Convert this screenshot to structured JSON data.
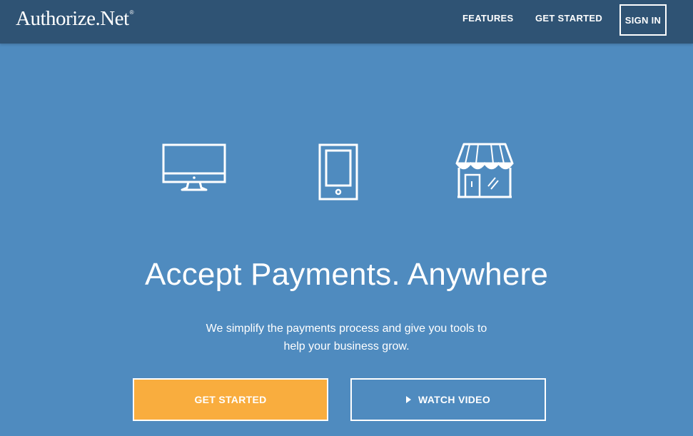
{
  "header": {
    "logo_text": "Authorize.Net",
    "logo_mark": "®",
    "nav": {
      "features": "FEATURES",
      "get_started": "GET STARTED",
      "sign_in": "SIGN IN"
    }
  },
  "hero": {
    "icons": [
      "desktop-monitor-icon",
      "mobile-phone-icon",
      "storefront-icon"
    ],
    "title": "Accept Payments. Anywhere",
    "subtitle_line1": "We simplify the payments process and give you tools to",
    "subtitle_line2": "help your business grow.",
    "buttons": {
      "primary": "GET STARTED",
      "secondary": "WATCH VIDEO"
    }
  },
  "colors": {
    "background": "#4f8bbf",
    "header": "#2f5374",
    "accent": "#f9ad3e",
    "text": "#ffffff"
  }
}
